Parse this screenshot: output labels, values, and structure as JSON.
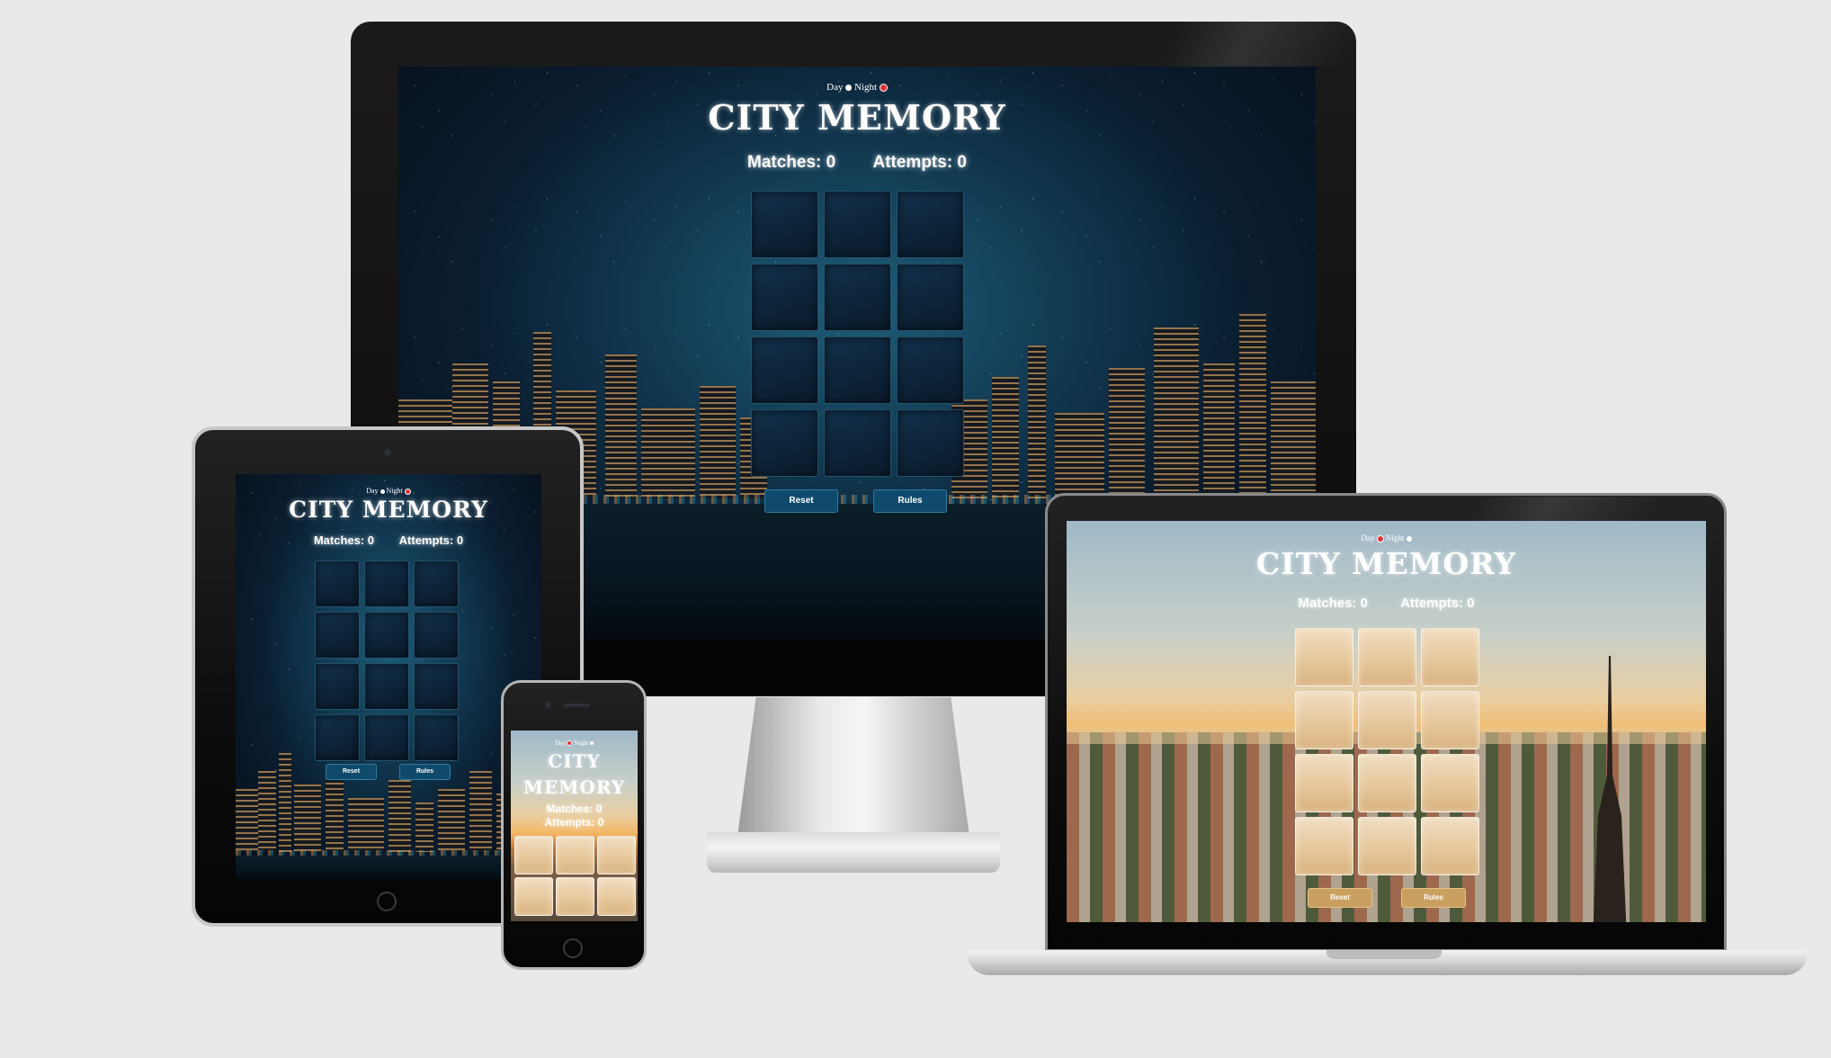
{
  "app": {
    "title": "CITY MEMORY",
    "title_line1": "CITY",
    "title_line2": "MEMORY",
    "mode_day": "Day",
    "mode_night": "Night",
    "matches_label": "Matches: 0",
    "attempts_label": "Attempts: 0",
    "reset_label": "Reset",
    "rules_label": "Rules"
  },
  "colors": {
    "night_accent": "#0f4a6c",
    "day_accent": "#c9a060",
    "toggle_active": "#e0303a",
    "page_bg": "#e9e9ea"
  },
  "icons": {
    "toggle_dot": "toggle-dot-icon"
  }
}
